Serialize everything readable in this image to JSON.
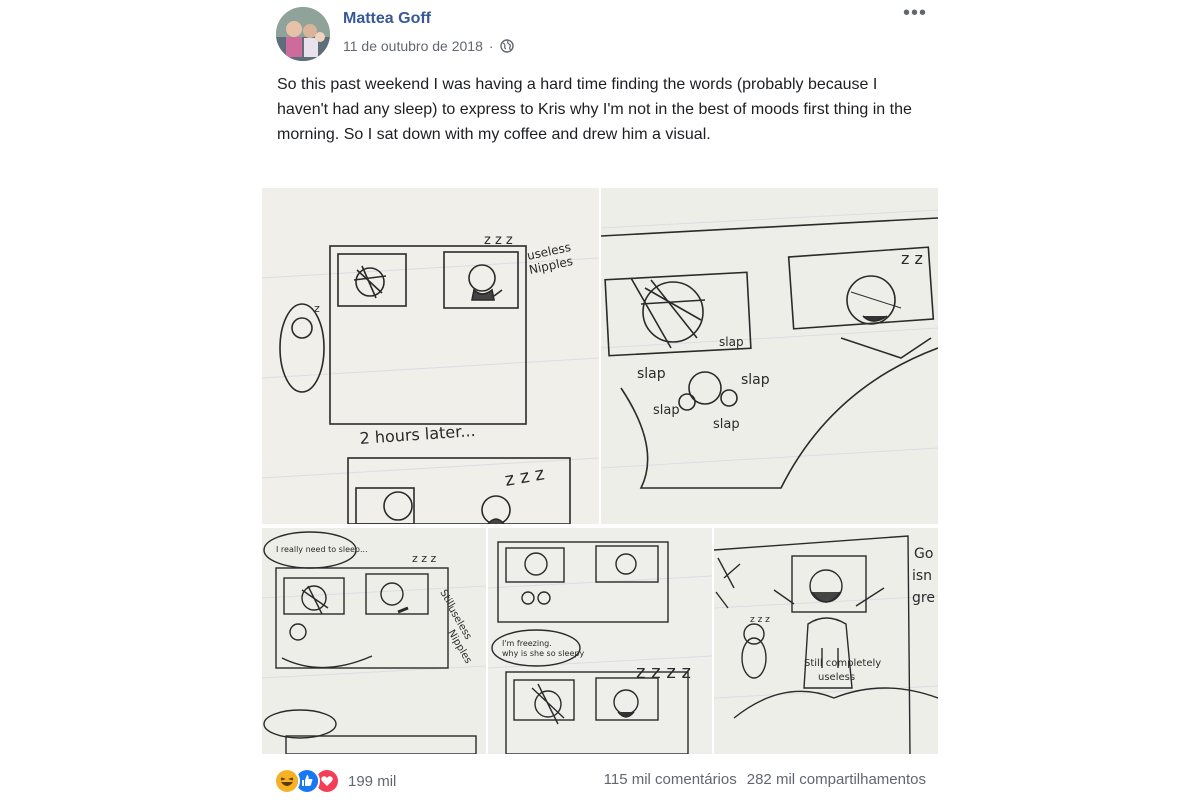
{
  "post": {
    "author": "Mattea Goff",
    "date": "11 de outubro de 2018",
    "separator": "·",
    "privacy_icon": "globe-icon",
    "more_icon": "ellipsis-icon",
    "more_label": "•••",
    "text": "So this past weekend I was having a hard time finding the words (probably because I haven't had any sleep) to express to Kris why I'm not in the best of moods first thing in the morning. So I sat down with my coffee and drew him a visual."
  },
  "photos": [
    {
      "name": "comic-photo-1",
      "labels": [
        "useless",
        "Nipples",
        "2 hours later...",
        "z",
        "z z z",
        "z z z"
      ]
    },
    {
      "name": "comic-photo-2",
      "labels": [
        "slap",
        "slap",
        "slap",
        "slap",
        "slap",
        "z z"
      ]
    },
    {
      "name": "comic-photo-3",
      "labels": [
        "I really need to sleep...",
        "Still",
        "useless",
        "Nipples",
        "z z z"
      ]
    },
    {
      "name": "comic-photo-4",
      "labels": [
        "I'm freezing.",
        "why is she so sleepy",
        "z z z z"
      ]
    },
    {
      "name": "comic-photo-5",
      "labels": [
        "Go",
        "isn",
        "gre",
        "Still completely",
        "useless",
        "z z z"
      ]
    }
  ],
  "footer": {
    "reaction_icons": [
      "haha-icon",
      "like-icon",
      "love-icon"
    ],
    "reactions_count": "199 mil",
    "comments": "115 mil comentários",
    "shares": "282 mil compartilhamentos"
  },
  "colors": {
    "author": "#385898",
    "meta": "#616770",
    "text": "#1c1e21",
    "like": "#1877f2",
    "love": "#f33e58",
    "haha": "#f7b125"
  }
}
